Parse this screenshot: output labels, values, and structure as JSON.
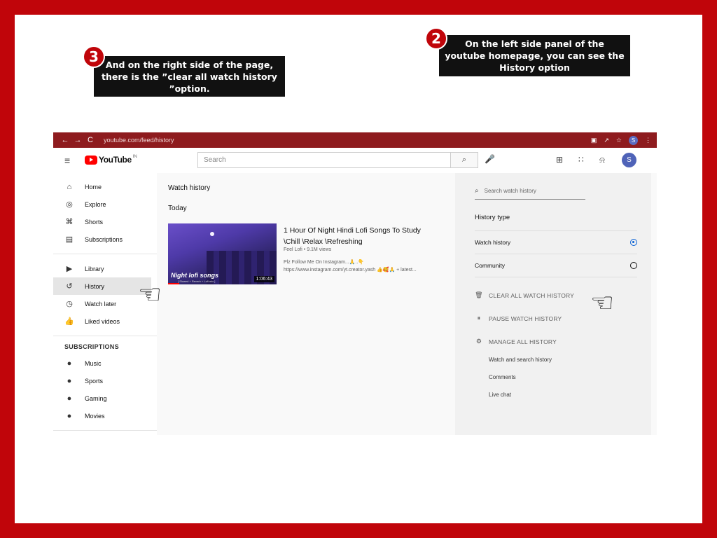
{
  "callouts": {
    "step3_number": "3",
    "step3_text": "And on the right side of the page, there is the ”clear all watch history ”option.",
    "step2_number": "2",
    "step2_text": "On the left side panel of the youtube homepage, you can see the History option"
  },
  "browser": {
    "url": "youtube.com/feed/history",
    "back_icon": "←",
    "forward_icon": "→",
    "reload_icon": "C",
    "lock_icon": "🔒",
    "profile_initial": "S"
  },
  "header": {
    "logo_text": "YouTube",
    "country_code": "IN",
    "search_placeholder": "Search",
    "avatar_initial": "S"
  },
  "sidebar": {
    "primary": [
      {
        "label": "Home",
        "icon": "⌂"
      },
      {
        "label": "Explore",
        "icon": "◎"
      },
      {
        "label": "Shorts",
        "icon": "⌘"
      },
      {
        "label": "Subscriptions",
        "icon": "▤"
      }
    ],
    "secondary": [
      {
        "label": "Library",
        "icon": "▶"
      },
      {
        "label": "History",
        "icon": "↺"
      },
      {
        "label": "Watch later",
        "icon": "◷"
      },
      {
        "label": "Liked videos",
        "icon": "👍"
      }
    ],
    "subscriptions_heading": "SUBSCRIPTIONS",
    "subscriptions": [
      {
        "label": "Music",
        "icon": "●"
      },
      {
        "label": "Sports",
        "icon": "●"
      },
      {
        "label": "Gaming",
        "icon": "●"
      },
      {
        "label": "Movies",
        "icon": "●"
      }
    ]
  },
  "main": {
    "title": "Watch history",
    "section": "Today",
    "video": {
      "thumbnail_title": "Night lofi songs",
      "thumbnail_subtitle": "[ Slowed + Reverb + Lofi mix ]",
      "duration": "1:06:43",
      "title": "1 Hour Of Night Hindi Lofi Songs To Study \\Chill \\Relax \\Refreshing",
      "meta": "Feel Lofi • 9.1M views",
      "description": "Plz Follow Me On Instagram...🙏..👇 https://www.instagram.com/yt.creator.yash 👍🥰🙏 + latest..."
    }
  },
  "right_panel": {
    "search_placeholder": "Search watch history",
    "history_type_label": "History type",
    "options": [
      {
        "label": "Watch history",
        "selected": true
      },
      {
        "label": "Community",
        "selected": false
      }
    ],
    "clear_all": "CLEAR ALL WATCH HISTORY",
    "pause": "PAUSE WATCH HISTORY",
    "manage": "MANAGE ALL HISTORY",
    "sub_links": [
      "Watch and search history",
      "Comments",
      "Live chat"
    ]
  },
  "colors": {
    "frame": "#c0050a",
    "browser_bar": "#8e1b1e",
    "accent_blue": "#065fd4",
    "youtube_red": "#ff0000"
  }
}
